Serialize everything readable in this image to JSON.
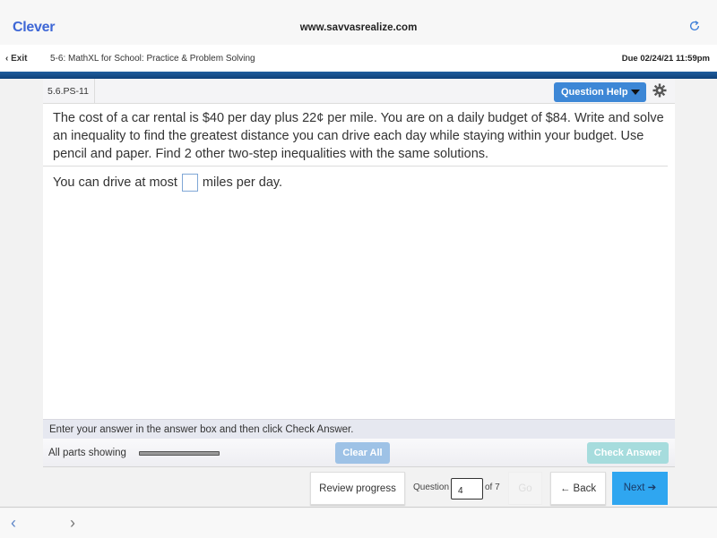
{
  "browser": {
    "logo": "Clever",
    "url": "www.savvasrealize.com",
    "reload_icon": "reload-icon"
  },
  "nav": {
    "exit_label": "Exit",
    "assignment_title": "5-6: MathXL for School: Practice & Problem Solving",
    "due": "Due 02/24/21 11:59pm"
  },
  "question": {
    "id": "5.6.PS-11",
    "help_label": "Question Help",
    "text": "The cost of a car rental is $40 per day plus 22¢ per mile. You are on a daily budget of $84. Write and solve an inequality to find the greatest distance you can drive each day while staying within your budget. Use pencil and paper. Find 2 other two-step inequalities with the same solutions.",
    "answer_prefix": "You can drive at most",
    "answer_value": "",
    "answer_suffix": "miles per day."
  },
  "instruction": "Enter your answer in the answer box and then click Check Answer.",
  "parts": {
    "label": "All parts showing",
    "progress": 1.0
  },
  "actions": {
    "clear_all": "Clear All",
    "check_answer": "Check Answer"
  },
  "footer": {
    "review_progress": "Review progress",
    "question_label": "Question",
    "question_number": "4",
    "of_total": "of 7",
    "go": "Go",
    "back": "← Back",
    "next": "Next ➔"
  },
  "bottom_nav": {
    "back": "‹",
    "forward": "›"
  }
}
